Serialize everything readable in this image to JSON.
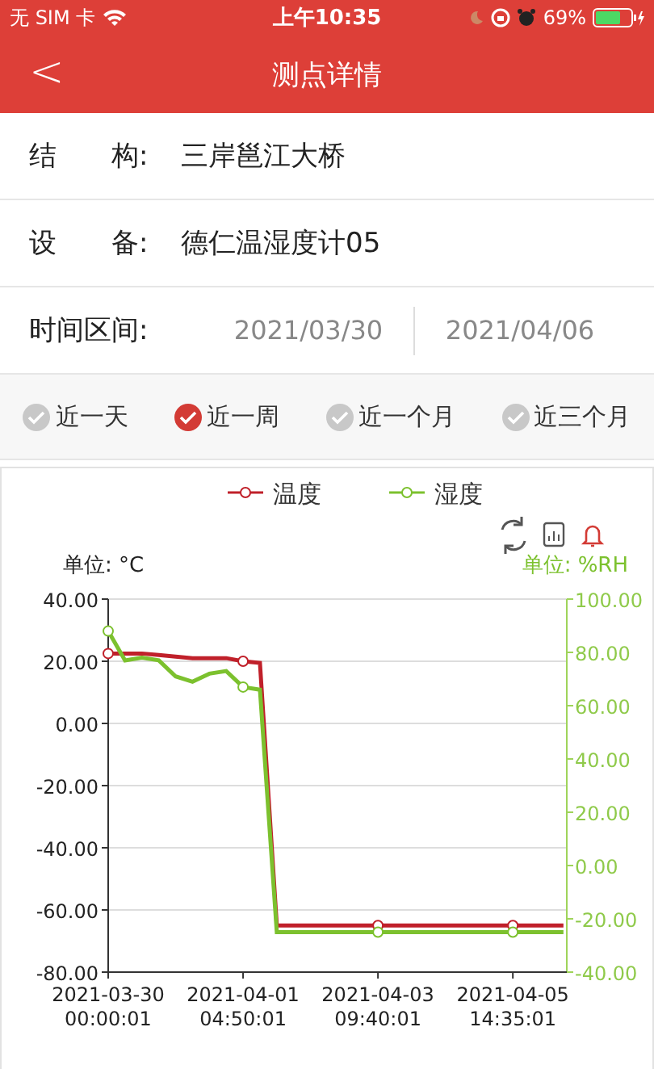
{
  "status_bar": {
    "carrier": "无 SIM 卡",
    "time": "上午10:35",
    "battery": "69%"
  },
  "nav": {
    "back": "<",
    "title": "测点详情"
  },
  "fields": [
    {
      "label": "结　　构:",
      "value": "三岸邕江大桥"
    },
    {
      "label": "设　　备:",
      "value": "德仁温湿度计05"
    }
  ],
  "time_range": {
    "label": "时间区间:",
    "start": "2021/03/30",
    "end": "2021/04/06"
  },
  "quick_ranges": [
    {
      "label": "近一天",
      "selected": false
    },
    {
      "label": "近一周",
      "selected": true
    },
    {
      "label": "近一个月",
      "selected": false
    },
    {
      "label": "近三个月",
      "selected": false
    }
  ],
  "chart": {
    "left_unit": "单位: °C",
    "right_unit": "单位: %RH",
    "chart_data": {
      "type": "line",
      "categories": [
        "2021-03-30 00:00:01",
        null,
        null,
        null,
        null,
        null,
        null,
        null,
        "2021-04-01 04:50:01",
        null,
        null,
        null,
        null,
        null,
        null,
        null,
        "2021-04-03 09:40:01",
        null,
        null,
        null,
        null,
        null,
        null,
        null,
        "2021-04-05 14:35:01",
        null,
        null,
        null
      ],
      "grid": true,
      "legend": "top",
      "ylim": [
        -80,
        40
      ],
      "yticks": [
        {
          "value": 40,
          "label": "40.00"
        },
        {
          "value": 20,
          "label": "20.00"
        },
        {
          "value": 0,
          "label": "0.00"
        },
        {
          "value": -20,
          "label": "-20.00"
        },
        {
          "value": -40,
          "label": "-40.00"
        },
        {
          "value": -60,
          "label": "-60.00"
        },
        {
          "value": -80,
          "label": "-80.00"
        }
      ],
      "y2lim": [
        -40,
        100
      ],
      "y2ticks": [
        {
          "value": 100,
          "label": "100.00"
        },
        {
          "value": 80,
          "label": "80.00"
        },
        {
          "value": 60,
          "label": "60.00"
        },
        {
          "value": 40,
          "label": "40.00"
        },
        {
          "value": 20,
          "label": "20.00"
        },
        {
          "value": 0,
          "label": "0.00"
        },
        {
          "value": -20,
          "label": "-20.00"
        },
        {
          "value": -40,
          "label": "-40.00"
        }
      ],
      "series": [
        {
          "name": "温度",
          "color": "#c0202a",
          "values": [
            22.5,
            22.5,
            22.5,
            22,
            21.5,
            21,
            21,
            21,
            20,
            19.5,
            -65,
            -65,
            -65,
            -65,
            -65,
            -65,
            -65,
            -65,
            -65,
            -65,
            -65,
            -65,
            -65,
            -65,
            -65,
            -65,
            -65,
            -65
          ]
        },
        {
          "name": "湿度",
          "color": "#7cc12e",
          "axis": "y2",
          "values": [
            88,
            77,
            78,
            77,
            71,
            69,
            72,
            73,
            67,
            66,
            -25,
            -25,
            -25,
            -25,
            -25,
            -25,
            -25,
            -25,
            -25,
            -25,
            -25,
            -25,
            -25,
            -25,
            -25,
            -25,
            -25,
            -25
          ]
        }
      ]
    }
  }
}
